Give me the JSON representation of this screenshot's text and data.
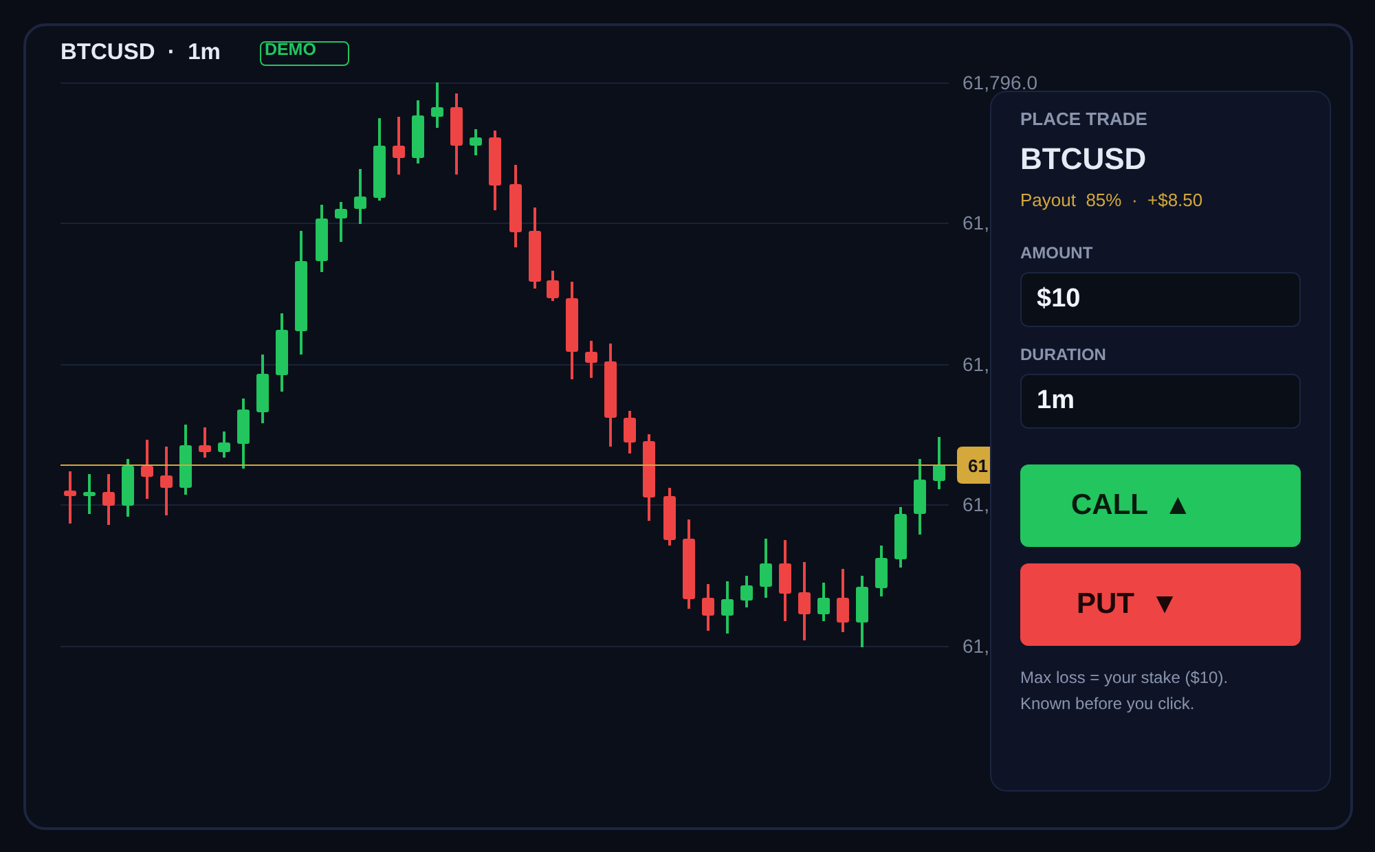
{
  "header": {
    "title": "BTCUSD  ·  1m",
    "badge": "DEMO"
  },
  "chart": {
    "axis_labels": [
      "61,796.0",
      "61,",
      "61,",
      "61,",
      "61,"
    ],
    "price_tag": "61"
  },
  "trade_panel": {
    "heading": "PLACE TRADE",
    "symbol": "BTCUSD",
    "payout": "Payout  85%  ·  +$8.50",
    "fields": [
      {
        "label": "AMOUNT",
        "value": "$10"
      },
      {
        "label": "DURATION",
        "value": "1m"
      }
    ],
    "buttons": [
      {
        "kind": "call",
        "label": "CALL  ▲"
      },
      {
        "kind": "put",
        "label": "PUT  ▼"
      }
    ],
    "notes": [
      "Max loss = your stake ($10).",
      "Known before you click."
    ]
  }
}
